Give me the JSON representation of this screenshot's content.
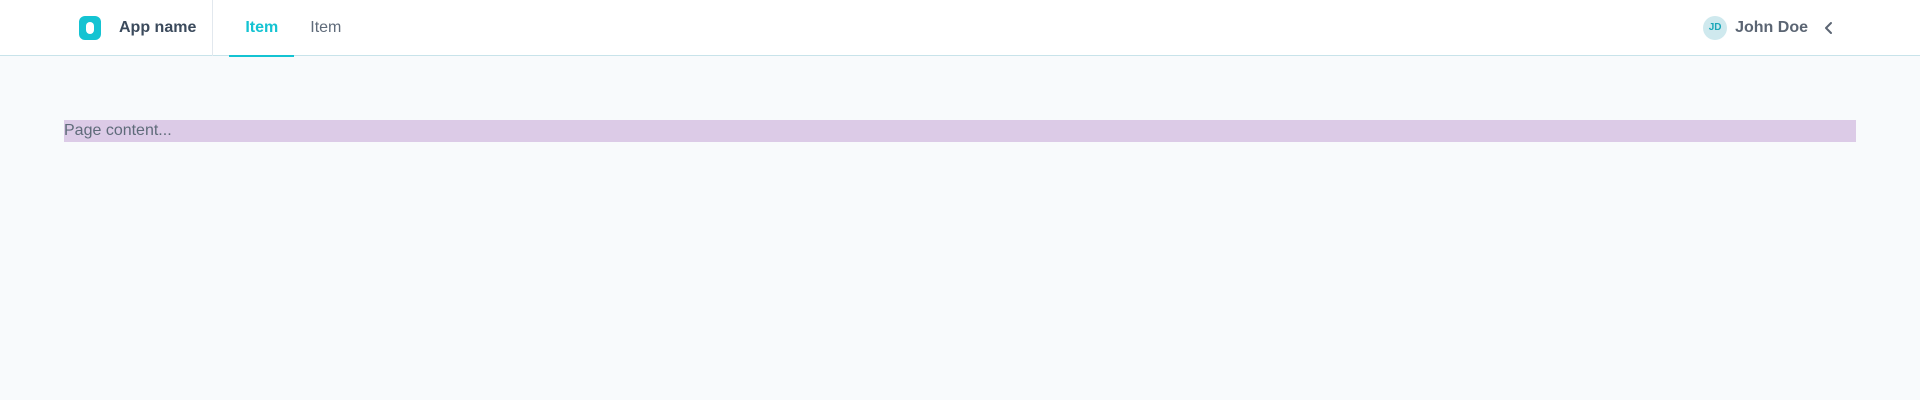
{
  "app": {
    "name": "App name",
    "logo_icon": "app-logo-icon"
  },
  "nav": {
    "tabs": [
      {
        "label": "Item",
        "active": true
      },
      {
        "label": "Item",
        "active": false
      }
    ]
  },
  "user": {
    "initials": "JD",
    "name": "John Doe",
    "menu_icon": "chevron-left-icon"
  },
  "main": {
    "content_text": "Page content..."
  },
  "colors": {
    "accent": "#14c3d2",
    "background": "#f8fafc",
    "content_highlight": "#dccbe7"
  }
}
